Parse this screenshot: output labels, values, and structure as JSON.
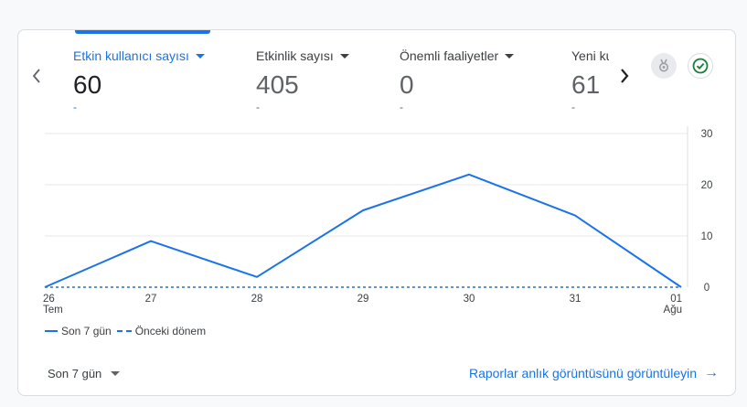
{
  "metrics": [
    {
      "title": "Etkin kullanıcı sayısı",
      "value": "60",
      "change": "-",
      "active": true
    },
    {
      "title": "Etkinlik sayısı",
      "value": "405",
      "change": "-"
    },
    {
      "title": "Önemli faaliyetler",
      "value": "0",
      "change": "-"
    },
    {
      "title": "Yeni kullanıcılar",
      "value": "61",
      "change": "-"
    }
  ],
  "icons": {
    "prev": "chevron-left-icon",
    "next": "chevron-right-icon",
    "award": "award-icon",
    "check": "check-circle-icon"
  },
  "colors": {
    "accent": "#1a73e8",
    "check": "#188038",
    "muted": "#5f6368"
  },
  "chart_data": {
    "type": "line",
    "x": [
      "26",
      "27",
      "28",
      "29",
      "30",
      "31",
      "01"
    ],
    "x_sublabels": [
      "Tem",
      "",
      "",
      "",
      "",
      "",
      "Ağu"
    ],
    "series": [
      {
        "name": "Son 7 gün",
        "values": [
          0,
          9,
          2,
          15,
          22,
          14,
          0
        ],
        "style": "solid"
      },
      {
        "name": "Önceki dönem",
        "values": [
          0,
          0,
          0,
          0,
          0,
          0,
          0
        ],
        "style": "dashed"
      }
    ],
    "y_ticks": [
      "0",
      "10",
      "20",
      "30"
    ],
    "ylim": [
      0,
      30
    ],
    "grid": true,
    "y_axis_side": "right",
    "legend_position": "bottom-left"
  },
  "footer": {
    "period_label": "Son 7 gün",
    "report_link": "Raporlar anlık görüntüsünü görüntüleyin"
  }
}
